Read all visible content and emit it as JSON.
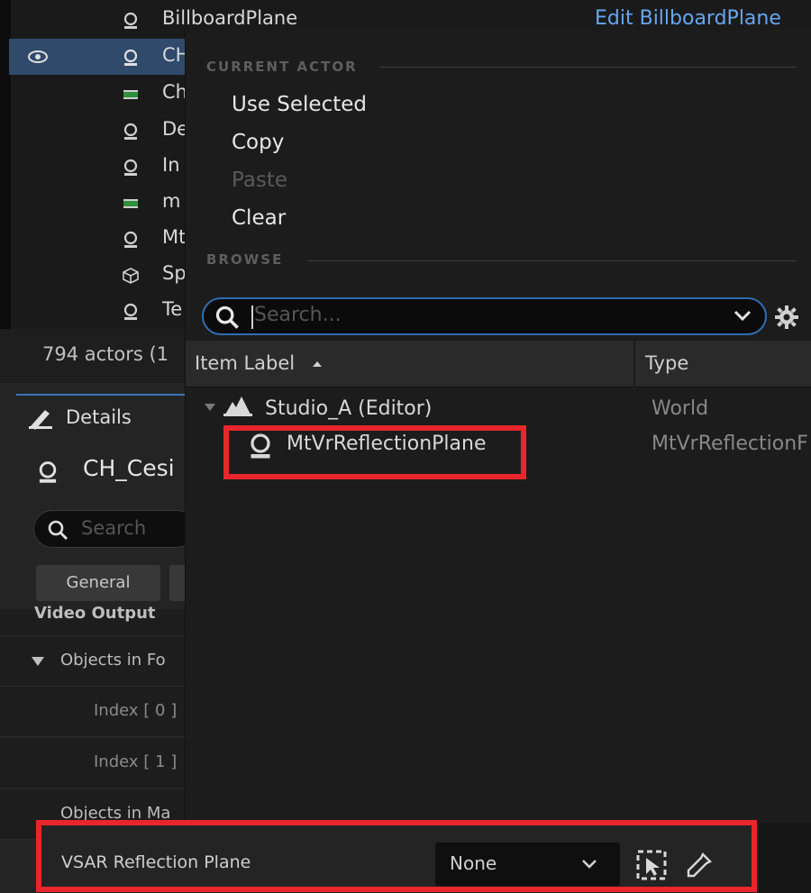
{
  "outliner": {
    "rows": [
      {
        "label": "BillboardPlane",
        "icon": "actor-icon"
      },
      {
        "label": "CH",
        "icon": "actor-icon",
        "selected": true
      },
      {
        "label": "Ch",
        "icon": "mesh-icon"
      },
      {
        "label": "De",
        "icon": "actor-icon"
      },
      {
        "label": "In",
        "icon": "actor-icon"
      },
      {
        "label": "m",
        "icon": "mesh-icon"
      },
      {
        "label": "Mt",
        "icon": "actor-icon"
      },
      {
        "label": "Sp",
        "icon": "cube-icon"
      },
      {
        "label": "Te",
        "icon": "actor-icon"
      }
    ],
    "edit_link": "Edit BillboardPlane",
    "footer": "794 actors (1"
  },
  "details": {
    "tab": "Details",
    "actor_name": "CH_Cesi",
    "search_placeholder": "Search",
    "category_button": "General",
    "rows": {
      "video_output": "Video Output",
      "objects_in_fo": "Objects in Fo",
      "index0": "Index [ 0 ]",
      "index1": "Index [ 1 ]",
      "objects_in_ma": "Objects in Ma"
    }
  },
  "popup": {
    "current_actor_header": "CURRENT ACTOR",
    "items": [
      "Use Selected",
      "Copy",
      "Paste",
      "Clear"
    ],
    "browse_header": "BROWSE",
    "search_placeholder": "Search...",
    "columns": {
      "label": "Item Label",
      "type": "Type"
    },
    "tree": {
      "world_label": "Studio_A (Editor)",
      "world_type": "World",
      "child_label": "MtVrReflectionPlane",
      "child_type": "MtVrReflectionF"
    }
  },
  "property": {
    "label": "VSAR Reflection Plane",
    "value": "None"
  },
  "colors": {
    "accent": "#2f6db0",
    "highlight": "#e8262b",
    "link": "#66a6ee"
  }
}
